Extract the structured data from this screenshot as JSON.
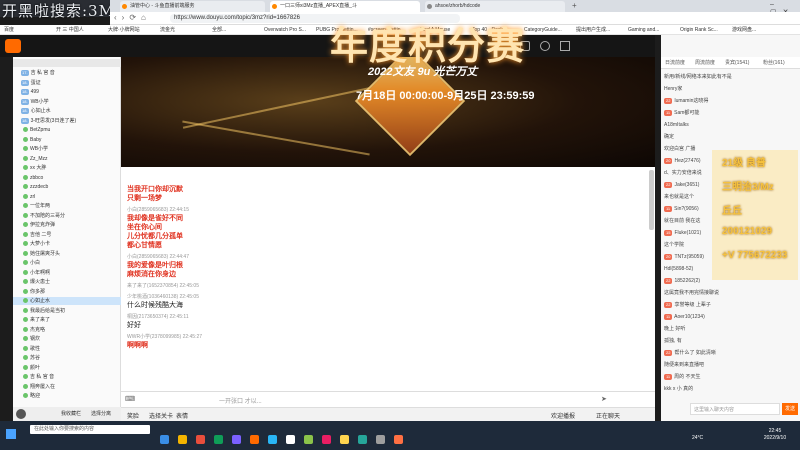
{
  "overlay": {
    "title": "开黑啦搜索:3Mz"
  },
  "browser": {
    "tabs": [
      {
        "label": "油管中心 - 斗鱼直播前端服务"
      },
      {
        "label": "一口三师xi3Mz直播_APEX直播_斗"
      },
      {
        "label": "ahsoe/zhorb/hdcode"
      }
    ],
    "url": "https://www.douyu.com/topic/3mz?rid=1667826",
    "bookmarks": [
      "百度",
      "开 三 中国人",
      "大牌·小牌网站",
      "流金光",
      "全部...",
      "Overwatch Pro S...",
      "PUBG Pro Settin...",
      "#screen_#sttin...",
      "Find A Mouse",
      "Top 40 - Rocket...",
      "CategoryGuide...",
      "提出用户生成...",
      "Gaming and...",
      "Origin Rank Sc...",
      "游戏网盘..."
    ]
  },
  "sidebar": {
    "rows": [
      "17.",
      "18.",
      "18.",
      "18.",
      "18.",
      "18.",
      "19.",
      "20.",
      "21.",
      "22.",
      "23.",
      "24.",
      "25.",
      "26.",
      "27.",
      "28.",
      "29.",
      "30.",
      "31.",
      "32.",
      "33.",
      "34.",
      "35.",
      "36.",
      "37.",
      "38.",
      "39.",
      "40.",
      "41.",
      "42.",
      "43.",
      "44.",
      "45."
    ],
    "names": [
      "吉 私 官 音",
      "蛋证",
      "499",
      "WB小学",
      "心如止水",
      "3-旺思发(3日连了差)",
      "BetZpmu",
      "Baby",
      "WB小学",
      "Zz_Mzz",
      "xx 大胖",
      "zbbco",
      "zzzdecb",
      "zrl",
      "一位年两",
      "不加陪的三哥分",
      "伊拉克炸弹",
      "吉他 二号",
      "大萝小卡",
      "她住屠爽牙头",
      "小白",
      "小年啊啊",
      "爆火患士",
      "你多那",
      "心如止水",
      "我最后给是当初",
      "来了来了",
      "杰克咯",
      "钢炊",
      "歌性",
      "苏谷",
      "颜叶",
      "吉 私 官 音",
      "翔奔屡入在",
      "略迎"
    ],
    "selected_index": 24,
    "footer_labels": [
      "我收藏栏",
      "选择分离"
    ]
  },
  "banner": {
    "title": "年度积分赛",
    "subtitle": "2022文友 9u 光芒万丈",
    "date": "7月18日 00:00:00-9月25日 23:59:59"
  },
  "chat": {
    "messages": [
      {
        "meta": "",
        "text": "当我开口你却沉默",
        "style": "red"
      },
      {
        "meta": "",
        "text": "只剩一场梦",
        "style": "red"
      },
      {
        "meta": "小白(2859065683) 22:44:15",
        "text": "我却像是雀好不同",
        "style": "red"
      },
      {
        "meta": "",
        "text": "坐在你心间",
        "style": "red"
      },
      {
        "meta": "",
        "text": "儿分忧都几分孤单",
        "style": "red"
      },
      {
        "meta": "",
        "text": "都心甘情愿",
        "style": "red"
      },
      {
        "meta": "小白(2859065683) 22:44:47",
        "text": "我的爱像是叶归根",
        "style": "red"
      },
      {
        "meta": "",
        "text": "麻烦消在你身边",
        "style": "red"
      },
      {
        "meta": "来了来了(1652370854) 22:45:05",
        "text": "",
        "style": "norm"
      },
      {
        "meta": "少年桃酒(1036460138) 22:45:05",
        "text": "什么时候残酷大海",
        "style": "norm"
      },
      {
        "meta": "桐因(2173650374) 22:45:11",
        "text": "好好",
        "style": "norm"
      },
      {
        "meta": "WWR小学(2378099985) 22:45:27",
        "text": "啊啊啊",
        "style": "red"
      }
    ],
    "input_placeholder": "一开张口 才以...",
    "toolbar": {
      "emoji": "笑脸",
      "gift": "选择关卡",
      "face": "表情"
    },
    "right_buttons": [
      "欢迎播报",
      "正在聊天"
    ]
  },
  "right_panel": {
    "tabs": [
      "日流前度",
      "周流前度",
      "贵宾(1541)",
      "粉丝(161)"
    ],
    "rows": [
      {
        "badge": "",
        "text": "新用/新线/网络本来如此有不是"
      },
      {
        "badge": "",
        "text": "Henry家"
      },
      {
        "badge": "22",
        "text": "lumamin这晓得"
      },
      {
        "badge": "11",
        "text": "Sam都可能"
      },
      {
        "badge": "",
        "text": "A18mItalks"
      },
      {
        "badge": "",
        "text": "确定"
      },
      {
        "badge": "",
        "text": "欢迎白宫 广播"
      },
      {
        "badge": "20",
        "text": "Hez(27476)"
      },
      {
        "badge": "",
        "text": "d、实力安倍来说"
      },
      {
        "badge": "22",
        "text": "Jake(3651)"
      },
      {
        "badge": "",
        "text": "来也就是这个"
      },
      {
        "badge": "11",
        "text": "Sin?(9056)"
      },
      {
        "badge": "",
        "text": "就在目前 我在这"
      },
      {
        "badge": "15",
        "text": "Fluke(1021)"
      },
      {
        "badge": "",
        "text": "这个学院"
      },
      {
        "badge": "20",
        "text": "TNTz(95059)"
      },
      {
        "badge": "",
        "text": "Hdl(5898-52)"
      },
      {
        "badge": "22",
        "text": "1852262(2)"
      },
      {
        "badge": "",
        "text": "这属竟我不用完情接聊说"
      },
      {
        "badge": "22",
        "text": "享誉等级 上辈子"
      },
      {
        "badge": "11",
        "text": "Aoer10(1234)"
      },
      {
        "badge": "",
        "text": "晚上 好听"
      },
      {
        "badge": "",
        "text": "孤独, 有"
      },
      {
        "badge": "22",
        "text": "帮什么了 如此清晰"
      },
      {
        "badge": "",
        "text": "随便来到来直播吧"
      },
      {
        "badge": "11",
        "text": "周的 不天生"
      },
      {
        "badge": "",
        "text": "kkk x 小 真的"
      }
    ],
    "overlay_lines": [
      "21级 良普",
      "三明治3/Mz",
      "丘丘",
      "200121029",
      "+V 775672233"
    ],
    "input_placeholder": "这里输入聊天内容",
    "send_button": "发送"
  },
  "taskbar": {
    "search_placeholder": "在此处输入你要搜索的内容",
    "weather": "24°C",
    "time": "22:45",
    "date": "2022/9/10"
  },
  "colors": {
    "accent": "#ff6a00",
    "danmu_red": "#e0311f",
    "gold": "#f6c23e"
  }
}
